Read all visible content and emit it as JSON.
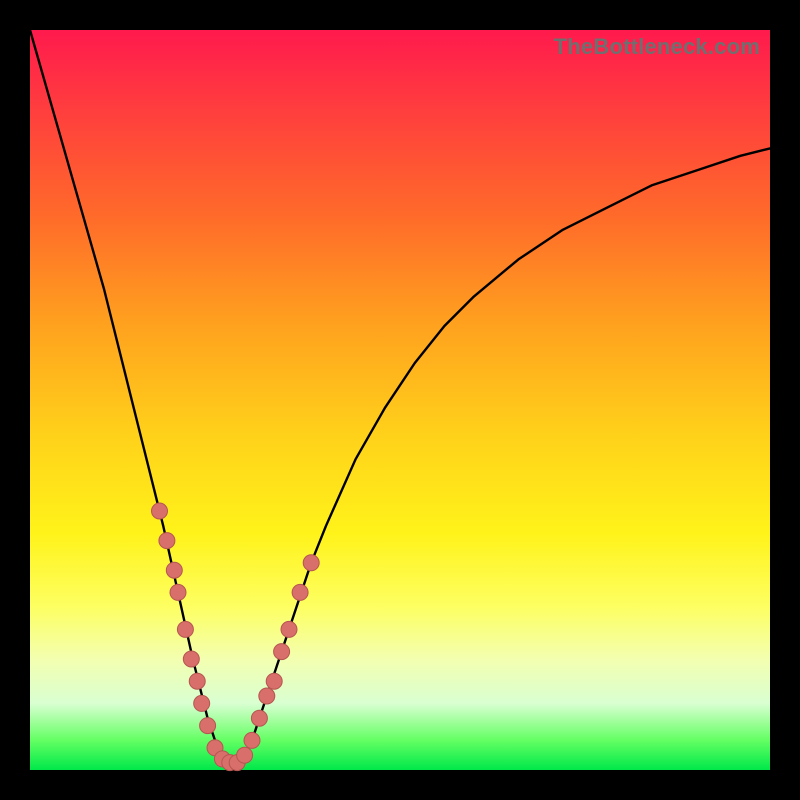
{
  "watermark": "TheBottleneck.com",
  "colors": {
    "frame": "#000000",
    "curve": "#000000",
    "marker_fill": "#d86f6a",
    "marker_stroke": "#b55651"
  },
  "chart_data": {
    "type": "line",
    "title": "",
    "xlabel": "",
    "ylabel": "",
    "xlim": [
      0,
      100
    ],
    "ylim": [
      0,
      100
    ],
    "x_optimum": 27,
    "series": [
      {
        "name": "bottleneck-curve",
        "x": [
          0,
          2,
          4,
          6,
          8,
          10,
          12,
          14,
          16,
          18,
          20,
          22,
          23,
          24,
          25,
          26,
          27,
          28,
          29,
          30,
          31,
          32,
          34,
          36,
          38,
          40,
          44,
          48,
          52,
          56,
          60,
          66,
          72,
          78,
          84,
          90,
          96,
          100
        ],
        "y": [
          100,
          93,
          86,
          79,
          72,
          65,
          57,
          49,
          41,
          33,
          24,
          15,
          11,
          7,
          4,
          2,
          1,
          1,
          2,
          4,
          7,
          10,
          16,
          22,
          28,
          33,
          42,
          49,
          55,
          60,
          64,
          69,
          73,
          76,
          79,
          81,
          83,
          84
        ]
      }
    ],
    "markers": {
      "name": "highlight-points",
      "x": [
        17.5,
        18.5,
        19.5,
        20.0,
        21.0,
        21.8,
        22.6,
        23.2,
        24.0,
        25.0,
        26.0,
        27.0,
        28.0,
        29.0,
        30.0,
        31.0,
        32.0,
        33.0,
        34.0,
        35.0,
        36.5,
        38.0
      ],
      "y": [
        35,
        31,
        27,
        24,
        19,
        15,
        12,
        9,
        6,
        3,
        1.5,
        1,
        1,
        2,
        4,
        7,
        10,
        12,
        16,
        19,
        24,
        28
      ]
    }
  }
}
